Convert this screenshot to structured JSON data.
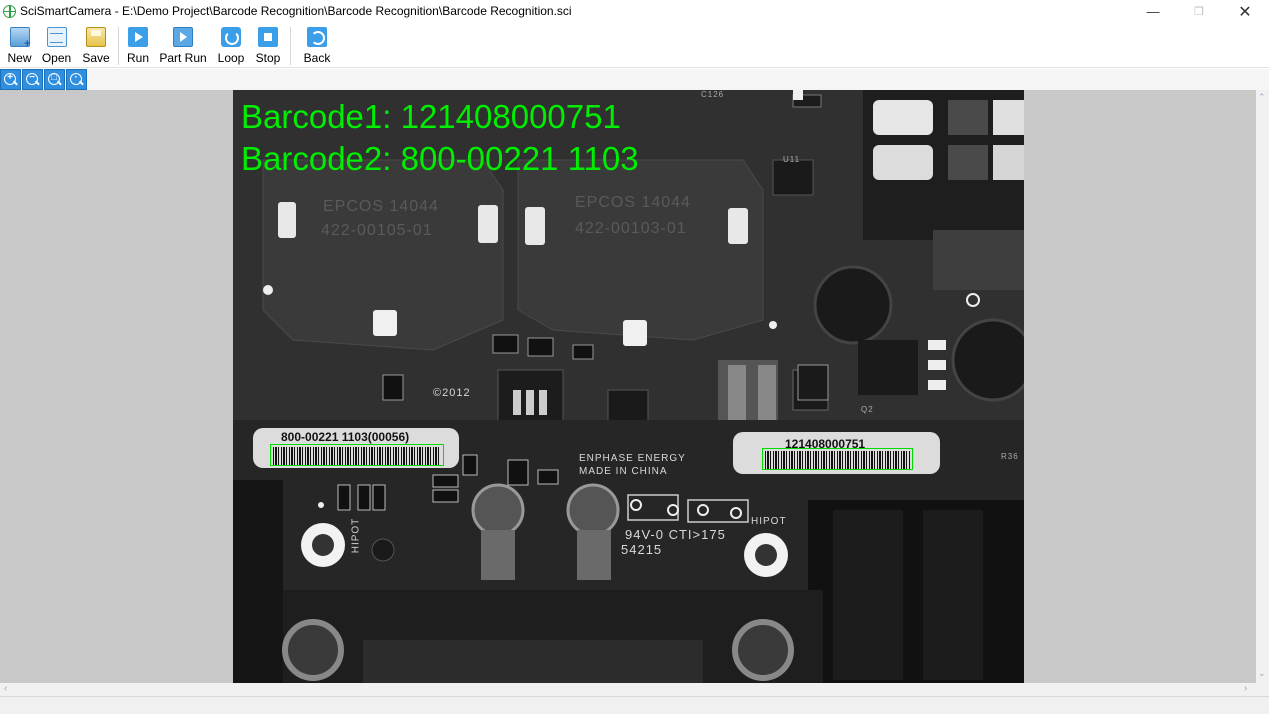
{
  "window": {
    "title": "SciSmartCamera - E:\\Demo Project\\Barcode Recognition\\Barcode Recognition\\Barcode Recognition.sci",
    "min_glyph": "—",
    "max_glyph": "❐",
    "close_glyph": "✕"
  },
  "toolbar": {
    "new_label": "New",
    "open_label": "Open",
    "save_label": "Save",
    "run_label": "Run",
    "partrun_label": "Part Run",
    "loop_label": "Loop",
    "stop_label": "Stop",
    "back_label": "Back"
  },
  "zoom": {
    "zoom_in_sign": "+",
    "zoom_out_sign": "−",
    "zoom_fit_sign": "□",
    "zoom_actual_sign": "·"
  },
  "image": {
    "result_line1": "Barcode1: 121408000751",
    "result_line2": "Barcode2: 800-00221 1103",
    "label_left_text": "800-00221 1103(00056)",
    "label_right_text": "121408000751",
    "silk_enphase": "ENPHASE ENERGY",
    "silk_made": "MADE IN CHINA",
    "silk_copyright": "©2012",
    "silk_cti": "94V-0 CTI>175",
    "silk_hipot_right": "HIPOT",
    "silk_hipot_left": "HIPOT",
    "silk_code": "54215",
    "silk_epcos1": "EPCOS 14044",
    "silk_epcos1b": "422-00105-01",
    "silk_epcos2": "EPCOS 14044",
    "silk_epcos2b": "422-00103-01",
    "silk_c126": "C126",
    "silk_u11": "U11",
    "silk_q2": "Q2",
    "silk_r36": "R36"
  },
  "colors": {
    "result_text": "#00ee00",
    "roi_box": "#00dd00",
    "workspace_bg": "#c8c8c8",
    "toolbar_icon_blue": "#3a9ee8"
  },
  "scroll": {
    "up_arrow": "⌃",
    "down_arrow": "⌄",
    "left_arrow": "‹",
    "right_arrow": "›"
  }
}
